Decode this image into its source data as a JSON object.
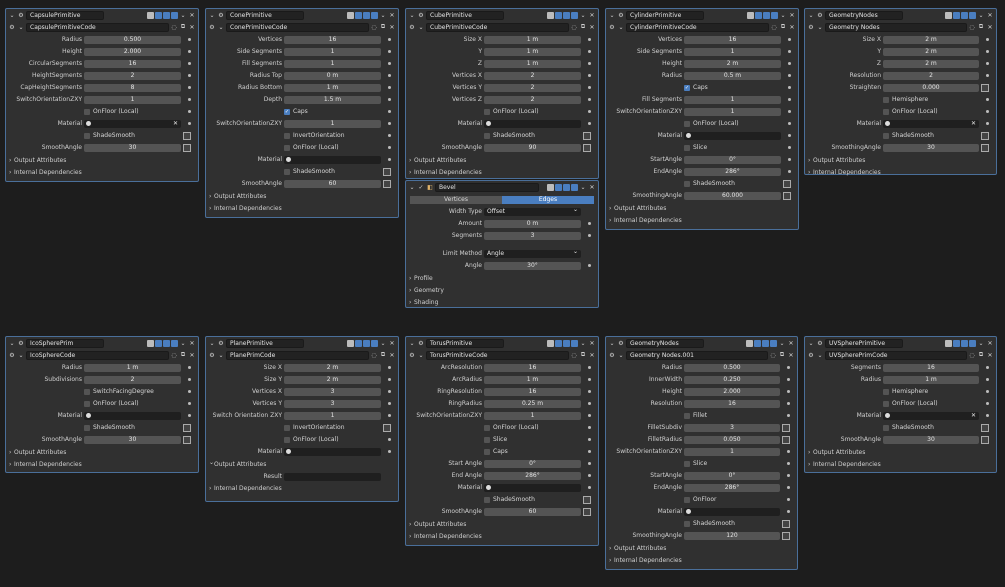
{
  "panels": [
    {
      "title": "CapsulePrimitive",
      "sub": "CapsulePrimitiveCode",
      "rows": [
        {
          "t": "n",
          "label": "Radius",
          "value": "0.500"
        },
        {
          "t": "n",
          "label": "Height",
          "value": "2.000"
        },
        {
          "t": "n",
          "label": "CircularSegments",
          "value": "16"
        },
        {
          "t": "n",
          "label": "HeightSegments",
          "value": "2"
        },
        {
          "t": "n",
          "label": "CapHeightSegments",
          "value": "8"
        },
        {
          "t": "n",
          "label": "SwitchOrientationZXY",
          "value": "1"
        },
        {
          "t": "c",
          "label": "OnFloor (Local)"
        },
        {
          "t": "o",
          "label": "Material",
          "x": true
        },
        {
          "t": "c",
          "label": "ShadeSmooth",
          "kf": true
        },
        {
          "t": "n",
          "label": "SmoothAngle",
          "value": "30",
          "kf": true
        }
      ],
      "sections": [
        "Output Attributes",
        "Internal Dependencies"
      ]
    },
    {
      "title": "ConePrimitive",
      "sub": "ConePrimitiveCode",
      "rows": [
        {
          "t": "n",
          "label": "Vertices",
          "value": "16"
        },
        {
          "t": "n",
          "label": "Side Segments",
          "value": "1"
        },
        {
          "t": "n",
          "label": "Fill Segments",
          "value": "1"
        },
        {
          "t": "n",
          "label": "Radius Top",
          "value": "0 m"
        },
        {
          "t": "n",
          "label": "Radius Bottom",
          "value": "1 m"
        },
        {
          "t": "n",
          "label": "Depth",
          "value": "1.5 m"
        },
        {
          "t": "c",
          "label": "Caps",
          "on": true
        },
        {
          "t": "n",
          "label": "SwitchOrientationZXY",
          "value": "1"
        },
        {
          "t": "c",
          "label": "InvertOrientation"
        },
        {
          "t": "c",
          "label": "OnFloor (Local)"
        },
        {
          "t": "o",
          "label": "Material"
        },
        {
          "t": "c",
          "label": "ShadeSmooth",
          "kf": true
        },
        {
          "t": "n",
          "label": "SmoothAngle",
          "value": "60",
          "kf": true
        }
      ],
      "sections": [
        "Output Attributes",
        "Internal Dependencies"
      ]
    },
    {
      "title": "CubePrimitive",
      "sub": "CubePrimitiveCode",
      "rows": [
        {
          "t": "n",
          "label": "Size X",
          "value": "1 m"
        },
        {
          "t": "n",
          "label": "Y",
          "value": "1 m"
        },
        {
          "t": "n",
          "label": "Z",
          "value": "1 m"
        },
        {
          "t": "n",
          "label": "Vertices X",
          "value": "2"
        },
        {
          "t": "n",
          "label": "Vertices Y",
          "value": "2"
        },
        {
          "t": "n",
          "label": "Vertices Z",
          "value": "2"
        },
        {
          "t": "c",
          "label": "OnFloor (Local)"
        },
        {
          "t": "o",
          "label": "Material"
        },
        {
          "t": "c",
          "label": "ShadeSmooth",
          "kf": true
        },
        {
          "t": "n",
          "label": "SmoothAngle",
          "value": "90",
          "kf": true
        }
      ],
      "sections": [
        "Output Attributes",
        "Internal Dependencies"
      ]
    },
    {
      "title": "CylinderPrimitive",
      "sub": "CylinderPrimitiveCode",
      "rows": [
        {
          "t": "n",
          "label": "Vertices",
          "value": "16"
        },
        {
          "t": "n",
          "label": "Side Segments",
          "value": "1"
        },
        {
          "t": "n",
          "label": "Height",
          "value": "2 m"
        },
        {
          "t": "n",
          "label": "Radius",
          "value": "0.5 m"
        },
        {
          "t": "c",
          "label": "Caps",
          "on": true
        },
        {
          "t": "n",
          "label": "Fill Segments",
          "value": "1"
        },
        {
          "t": "n",
          "label": "SwitchOrientationZXY",
          "value": "1"
        },
        {
          "t": "c",
          "label": "OnFloor (Local)"
        },
        {
          "t": "o",
          "label": "Material"
        },
        {
          "t": "c",
          "label": "Slice"
        },
        {
          "t": "n",
          "label": "StartAngle",
          "value": "0°"
        },
        {
          "t": "n",
          "label": "EndAngle",
          "value": "286°"
        },
        {
          "t": "c",
          "label": "ShadeSmooth",
          "kf": true
        },
        {
          "t": "n",
          "label": "SmoothingAngle",
          "value": "60.000",
          "kf": true
        }
      ],
      "sections": [
        "Output Attributes",
        "Internal Dependencies"
      ]
    },
    {
      "title": "GeometryNodes",
      "sub": "Geometry Nodes",
      "rows": [
        {
          "t": "n",
          "label": "Size X",
          "value": "2 m"
        },
        {
          "t": "n",
          "label": "Y",
          "value": "2 m"
        },
        {
          "t": "n",
          "label": "Z",
          "value": "2 m"
        },
        {
          "t": "n",
          "label": "Resolution",
          "value": "2"
        },
        {
          "t": "n",
          "label": "Straighten",
          "value": "0.000",
          "kf": true
        },
        {
          "t": "c",
          "label": "Hemisphere"
        },
        {
          "t": "c",
          "label": "OnFloor (Local)"
        },
        {
          "t": "o",
          "label": "Material",
          "x": true
        },
        {
          "t": "c",
          "label": "ShadeSmooth",
          "kf": true
        },
        {
          "t": "n",
          "label": "SmoothingAngle",
          "value": "30",
          "kf": true
        }
      ],
      "sections": [
        "Output Attributes",
        "Internal Dependencies"
      ]
    },
    {
      "title": "Bevel",
      "bevel": true,
      "rows": [
        {
          "t": "seg",
          "a": "Vertices",
          "b": "Edges"
        },
        {
          "t": "d",
          "label": "Width Type",
          "value": "Offset"
        },
        {
          "t": "n",
          "label": "Amount",
          "value": "0 m"
        },
        {
          "t": "n",
          "label": "Segments",
          "value": "3"
        },
        {
          "t": "gap"
        },
        {
          "t": "d",
          "label": "Limit Method",
          "value": "Angle"
        },
        {
          "t": "n",
          "label": "Angle",
          "value": "30°"
        }
      ],
      "sections": [
        "Profile",
        "Geometry",
        "Shading"
      ]
    },
    {
      "title": "IcoSpherePrim",
      "sub": "IcoSphereCode",
      "rows": [
        {
          "t": "n",
          "label": "Radius",
          "value": "1 m"
        },
        {
          "t": "n",
          "label": "Subdivisions",
          "value": "2"
        },
        {
          "t": "c",
          "label": "SwitchFacingDegree"
        },
        {
          "t": "c",
          "label": "OnFloor (Local)"
        },
        {
          "t": "o",
          "label": "Material"
        },
        {
          "t": "c",
          "label": "ShadeSmooth",
          "kf": true
        },
        {
          "t": "n",
          "label": "SmoothAngle",
          "value": "30",
          "kf": true
        }
      ],
      "sections": [
        "Output Attributes",
        "Internal Dependencies"
      ]
    },
    {
      "title": "PlanePrimitive",
      "sub": "PlanePrimCode",
      "rows": [
        {
          "t": "n",
          "label": "Size X",
          "value": "2 m"
        },
        {
          "t": "n",
          "label": "Size Y",
          "value": "2 m"
        },
        {
          "t": "n",
          "label": "Vertices X",
          "value": "3"
        },
        {
          "t": "n",
          "label": "Vertices Y",
          "value": "3"
        },
        {
          "t": "n",
          "label": "Switch Orientation ZXY",
          "value": "1"
        },
        {
          "t": "c",
          "label": "InvertOrientation",
          "kf": true
        },
        {
          "t": "c",
          "label": "OnFloor (Local)"
        },
        {
          "t": "o",
          "label": "Material"
        }
      ],
      "sections": [
        "Output Attributes"
      ],
      "result": "Result",
      "sections2": [
        "Internal Dependencies"
      ]
    },
    {
      "title": "TorusPrimitive",
      "sub": "TorusPrimitiveCode",
      "rows": [
        {
          "t": "n",
          "label": "ArcResolution",
          "value": "16"
        },
        {
          "t": "n",
          "label": "ArcRadius",
          "value": "1 m"
        },
        {
          "t": "n",
          "label": "RingResolution",
          "value": "16"
        },
        {
          "t": "n",
          "label": "RingRadius",
          "value": "0.25 m"
        },
        {
          "t": "n",
          "label": "SwitchOrientationZXY",
          "value": "1"
        },
        {
          "t": "c",
          "label": "OnFloor (Local)"
        },
        {
          "t": "c",
          "label": "Slice"
        },
        {
          "t": "c",
          "label": "Caps"
        },
        {
          "t": "n",
          "label": "Start Angle",
          "value": "0°"
        },
        {
          "t": "n",
          "label": "End Angle",
          "value": "286°"
        },
        {
          "t": "o",
          "label": "Material"
        },
        {
          "t": "c",
          "label": "ShadeSmooth",
          "kf": true
        },
        {
          "t": "n",
          "label": "SmoothAngle",
          "value": "60",
          "kf": true
        }
      ],
      "sections": [
        "Output Attributes",
        "Internal Dependencies"
      ]
    },
    {
      "title": "GeometryNodes",
      "sub": "Geometry Nodes.001",
      "rows": [
        {
          "t": "n",
          "label": "Radius",
          "value": "0.500"
        },
        {
          "t": "n",
          "label": "InnerWidth",
          "value": "0.250"
        },
        {
          "t": "n",
          "label": "Height",
          "value": "2.000"
        },
        {
          "t": "n",
          "label": "Resolution",
          "value": "16"
        },
        {
          "t": "c",
          "label": "Fillet"
        },
        {
          "t": "n",
          "label": "FilletSubdiv",
          "value": "3",
          "kf": true
        },
        {
          "t": "n",
          "label": "FilletRadius",
          "value": "0.050",
          "kf": true
        },
        {
          "t": "n",
          "label": "SwitchOrientationZXY",
          "value": "1"
        },
        {
          "t": "c",
          "label": "Slice"
        },
        {
          "t": "n",
          "label": "StartAngle",
          "value": "0°"
        },
        {
          "t": "n",
          "label": "EndAngle",
          "value": "286°"
        },
        {
          "t": "c",
          "label": "OnFloor"
        },
        {
          "t": "o",
          "label": "Material"
        },
        {
          "t": "c",
          "label": "ShadeSmooth",
          "kf": true
        },
        {
          "t": "n",
          "label": "SmoothingAngle",
          "value": "120",
          "kf": true
        }
      ],
      "sections": [
        "Output Attributes",
        "Internal Dependencies"
      ]
    },
    {
      "title": "UVSpherePrimitive",
      "sub": "UVSpherePrimCode",
      "rows": [
        {
          "t": "n",
          "label": "Segments",
          "value": "16"
        },
        {
          "t": "n",
          "label": "Radius",
          "value": "1 m"
        },
        {
          "t": "c",
          "label": "Hemisphere"
        },
        {
          "t": "c",
          "label": "OnFloor (Local)"
        },
        {
          "t": "o",
          "label": "Material",
          "x": true
        },
        {
          "t": "c",
          "label": "ShadeSmooth",
          "kf": true
        },
        {
          "t": "n",
          "label": "SmoothAngle",
          "value": "30",
          "kf": true
        }
      ],
      "sections": [
        "Output Attributes",
        "Internal Dependencies"
      ]
    }
  ]
}
